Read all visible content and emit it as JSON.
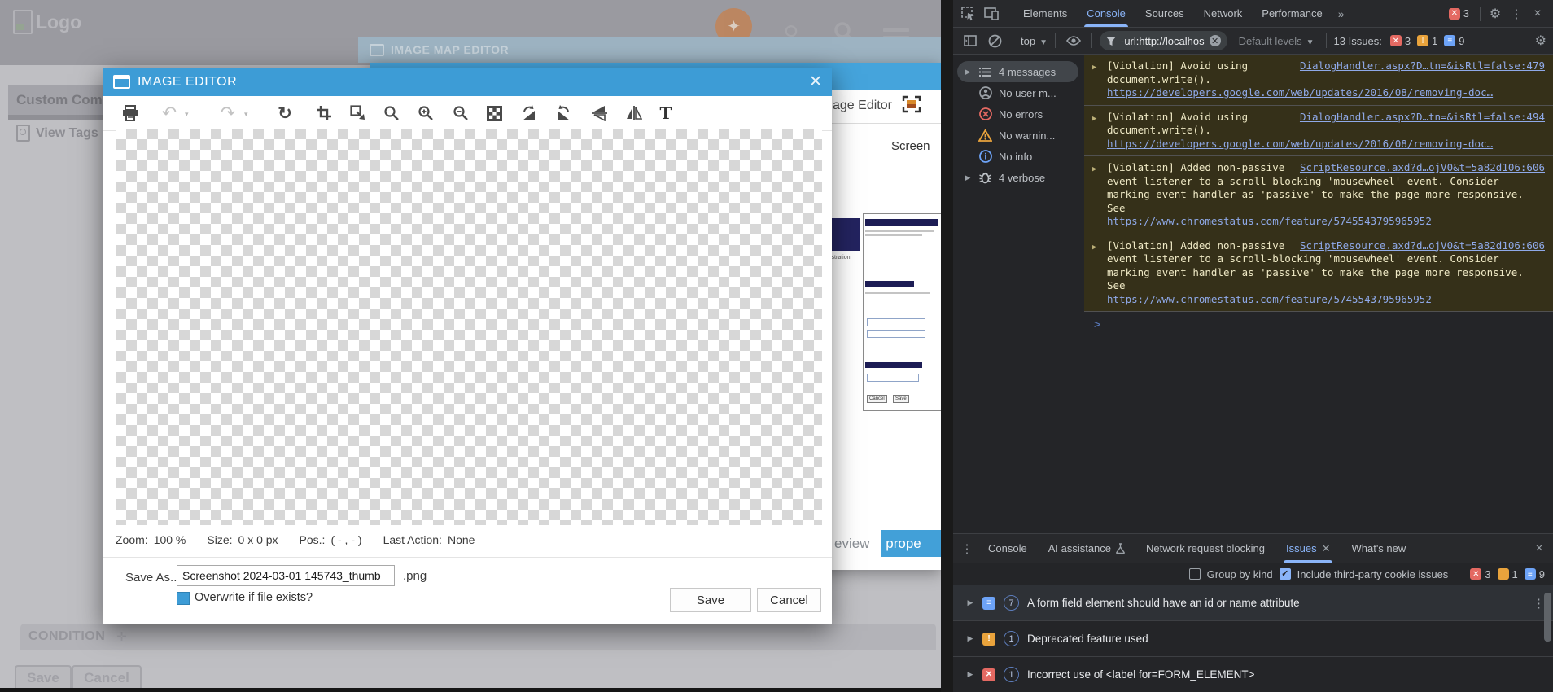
{
  "colors": {
    "dialog_accent": "#3d9cd6",
    "devtools_accent": "#8ab4f8",
    "violation_bg": "#353019",
    "error_red": "#e46962",
    "warning_orange": "#e9a33c",
    "info_blue": "#6da3f7"
  },
  "page": {
    "logo": "Logo",
    "component_tab": "Custom Comp",
    "view_tags": "View Tags",
    "condition": "CONDITION",
    "save": "Save",
    "cancel": "Cancel"
  },
  "manager_window": {
    "title": "IMAGE MAP EDITOR",
    "editor_tab": "age Editor",
    "file_label": "Screen",
    "thumb_fragment": "istration",
    "thumb_cancel": "Cancel",
    "thumb_save": "Save",
    "preview_tab": "eview",
    "properties_tab": "prope"
  },
  "dialog": {
    "title": "IMAGE EDITOR",
    "toolbar_icons": [
      "print",
      "undo",
      "redo",
      "refresh",
      "crop",
      "resize",
      "zoom",
      "zoom-in",
      "zoom-out",
      "transparency",
      "rotate-right",
      "rotate-left",
      "flip-vertical",
      "flip-horizontal",
      "text"
    ],
    "status": {
      "zoom_label": "Zoom:",
      "zoom_value": "100 %",
      "size_label": "Size:",
      "size_value": "0 x 0 px",
      "pos_label": "Pos.:",
      "pos_value": "( - , - )",
      "last_action_label": "Last Action:",
      "last_action_value": "None"
    },
    "save_as_label": "Save As...",
    "filename": "Screenshot 2024-03-01 145743_thumb",
    "extension": ".png",
    "overwrite_label": "Overwrite if file exists?",
    "overwrite_checked": true,
    "save_button": "Save",
    "cancel_button": "Cancel",
    "close_glyph": "✕"
  },
  "devtools": {
    "main_tabs": [
      "Elements",
      "Console",
      "Sources",
      "Network",
      "Performance"
    ],
    "active_main_tab": "Console",
    "overflow_chevron": "»",
    "error_badge_count": "3",
    "toolbar": {
      "context_label": "top",
      "filter_value": "-url:http://localhos",
      "levels_label": "Default levels",
      "issues_summary": "13 Issues:",
      "issues_counts": {
        "errors": "3",
        "warnings": "1",
        "info": "9"
      }
    },
    "sidebar": [
      {
        "label": "4 messages"
      },
      {
        "label": "No user m..."
      },
      {
        "label": "No errors"
      },
      {
        "label": "No warnin..."
      },
      {
        "label": "No info"
      },
      {
        "label": "4 verbose"
      }
    ],
    "console_messages": [
      {
        "prefix": "[Violation]",
        "body": "Avoid using document.write().",
        "source": "DialogHandler.aspx?D…tn=&isRtl=false:479",
        "url": "https://developers.google.com/web/updates/2016/08/removing-doc…"
      },
      {
        "prefix": "[Violation]",
        "body": "Avoid using document.write().",
        "source": "DialogHandler.aspx?D…tn=&isRtl=false:494",
        "url": "https://developers.google.com/web/updates/2016/08/removing-doc…"
      },
      {
        "prefix": "[Violation]",
        "body": "Added non-passive event listener to a scroll-blocking 'mousewheel' event. Consider marking event handler as 'passive' to make the page more responsive. See",
        "source": "ScriptResource.axd?d…ojV0&t=5a82d106:606",
        "url": "https://www.chromestatus.com/feature/5745543795965952"
      },
      {
        "prefix": "[Violation]",
        "body": "Added non-passive event listener to a scroll-blocking 'mousewheel' event. Consider marking event handler as 'passive' to make the page more responsive. See",
        "source": "ScriptResource.axd?d…ojV0&t=5a82d106:606",
        "url": "https://www.chromestatus.com/feature/5745543795965952"
      }
    ],
    "prompt_glyph": ">",
    "drawer": {
      "tabs": [
        "Console",
        "AI assistance",
        "Network request blocking",
        "Issues",
        "What's new"
      ],
      "active_tab": "Issues",
      "group_by_kind_label": "Group by kind",
      "group_by_kind_checked": false,
      "third_party_label": "Include third-party cookie issues",
      "third_party_checked": true,
      "counts": {
        "errors": "3",
        "warnings": "1",
        "info": "9"
      },
      "issues": [
        {
          "severity": "info",
          "count": "7",
          "title": "A form field element should have an id or name attribute"
        },
        {
          "severity": "warning",
          "count": "1",
          "title": "Deprecated feature used"
        },
        {
          "severity": "error",
          "count": "1",
          "title": "Incorrect use of <label for=FORM_ELEMENT>"
        }
      ]
    }
  }
}
